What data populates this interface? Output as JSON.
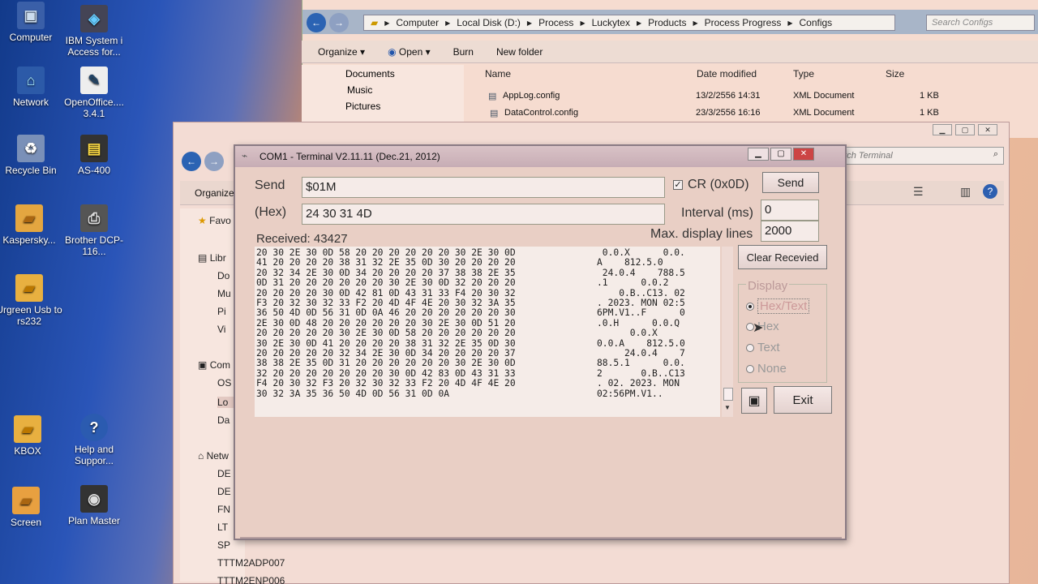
{
  "desktop": {
    "icons": [
      {
        "label": "Computer",
        "icon": "computer-icon"
      },
      {
        "label": "IBM System i Access for...",
        "icon": "ibm-icon"
      },
      {
        "label": "Network",
        "icon": "network-icon"
      },
      {
        "label": "OpenOffice.... 3.4.1",
        "icon": "openoffice-icon"
      },
      {
        "label": "Recycle Bin",
        "icon": "recycle-bin-icon"
      },
      {
        "label": "AS-400",
        "icon": "as400-icon"
      },
      {
        "label": "Kaspersky...",
        "icon": "kaspersky-icon"
      },
      {
        "label": "Brother DCP-116...",
        "icon": "printer-icon"
      },
      {
        "label": "Urgreen Usb to rs232",
        "icon": "folder-icon"
      },
      {
        "label": "KBOX",
        "icon": "folder-icon"
      },
      {
        "label": "Help and Suppor...",
        "icon": "help-icon"
      },
      {
        "label": "Screen",
        "icon": "folder-icon"
      },
      {
        "label": "Plan Master",
        "icon": "plan-master-icon"
      }
    ]
  },
  "explorer": {
    "breadcrumbs": [
      "Computer",
      "Local Disk (D:)",
      "Process",
      "Luckytex",
      "Products",
      "Process Progress",
      "Configs"
    ],
    "search_placeholder": "Search Configs",
    "toolbar": {
      "organize": "Organize ▾",
      "open": "Open ▾",
      "burn": "Burn",
      "new_folder": "New folder"
    },
    "tree": [
      "Documents",
      "Music",
      "Pictures"
    ],
    "columns": {
      "name": "Name",
      "date": "Date modified",
      "type": "Type",
      "size": "Size"
    },
    "files": [
      {
        "name": "AppLog.config",
        "date": "13/2/2556 14:31",
        "type": "XML Document",
        "size": "1 KB"
      },
      {
        "name": "DataControl.config",
        "date": "23/3/2556 16:16",
        "type": "XML Document",
        "size": "1 KB"
      }
    ]
  },
  "explorer2": {
    "organize": "Organize",
    "search_placeholder": "Search Terminal",
    "nav": [
      "Favo",
      "Libr",
      "Do",
      "Mu",
      "Pi",
      "Vi",
      "Com",
      "OS",
      "Lo",
      "Da",
      "Netw",
      "DE",
      "DE",
      "FN",
      "LT",
      "SP",
      "TTTM2ADP007",
      "TTTM2ENP006"
    ]
  },
  "terminal": {
    "title": "COM1 - Terminal V2.11.11 (Dec.21, 2012)",
    "send_label": "Send",
    "send_value": "$01M",
    "hex_label": "(Hex)",
    "hex_value": "24 30 31 4D",
    "cr_label": "CR (0x0D)",
    "send_button": "Send",
    "interval_label": "Interval (ms)",
    "interval_value": "0",
    "max_lines_label": "Max. display lines",
    "max_lines_value": "2000",
    "received_label": "Received: 43427",
    "clear_button": "Clear Recevied",
    "display_label": "Display",
    "display_options": [
      "Hex/Text",
      "Hex",
      "Text",
      "None"
    ],
    "display_selected": "Hex/Text",
    "exit_button": "Exit",
    "hex_lines": [
      "20 30 2E 30 0D 58 20 20 20 20 20 20 30 2E 30 0D",
      "41 20 20 20 20 38 31 32 2E 35 0D 30 20 20 20 20",
      "20 32 34 2E 30 0D 34 20 20 20 20 37 38 38 2E 35",
      "0D 31 20 20 20 20 20 20 30 2E 30 0D 32 20 20 20",
      "20 20 20 20 30 0D 42 81 0D 43 31 33 F4 20 30 32",
      "F3 20 32 30 32 33 F2 20 4D 4F 4E 20 30 32 3A 35",
      "36 50 4D 0D 56 31 0D 0A 46 20 20 20 20 20 20 30",
      "2E 30 0D 48 20 20 20 20 20 20 30 2E 30 0D 51 20",
      "20 20 20 20 20 30 2E 30 0D 58 20 20 20 20 20 20",
      "30 2E 30 0D 41 20 20 20 20 38 31 32 2E 35 0D 30",
      "20 20 20 20 20 32 34 2E 30 0D 34 20 20 20 20 37",
      "38 38 2E 35 0D 31 20 20 20 20 20 20 30 2E 30 0D",
      "32 20 20 20 20 20 20 20 30 0D 42 83 0D 43 31 33",
      "F4 20 30 32 F3 20 32 30 32 33 F2 20 4D 4F 4E 20",
      "30 32 3A 35 36 50 4D 0D 56 31 0D 0A"
    ],
    "text_lines": [
      " 0.0.X      0.0.",
      "A    812.5.0",
      " 24.0.4    788.5",
      ".1      0.0.2",
      "    0.B..C13. 02",
      ". 2023. MON 02:5",
      "6PM.V1..F      0",
      ".0.H      0.0.Q",
      "      0.0.X",
      "0.0.A    812.5.0",
      "     24.0.4    7",
      "88.5.1      0.0.",
      "2       0.B..C13",
      ". 02. 2023. MON ",
      "02:56PM.V1.."
    ]
  }
}
